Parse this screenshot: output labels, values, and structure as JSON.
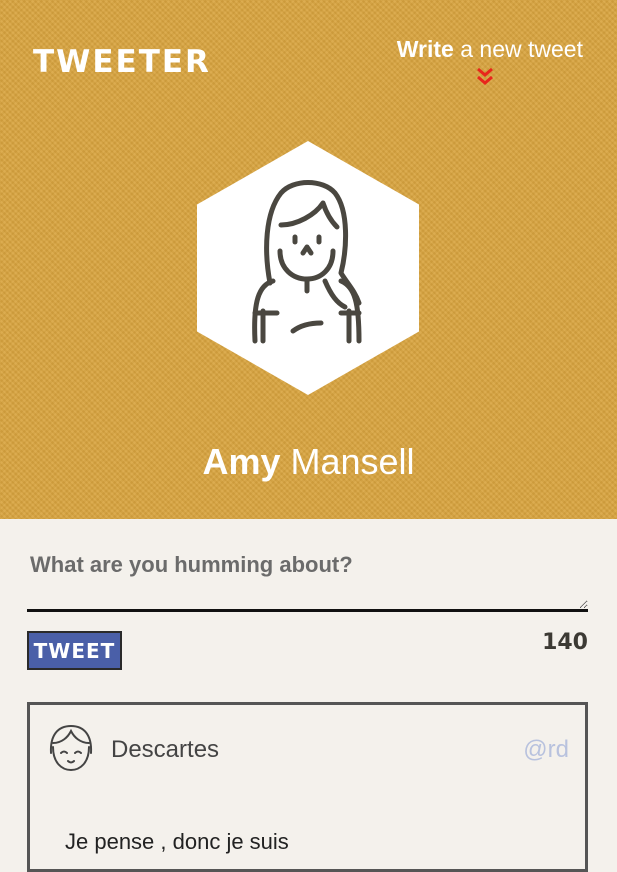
{
  "app": {
    "logo": "Tweeter"
  },
  "header": {
    "write_bold": "Write",
    "write_rest": " a new tweet",
    "colors": {
      "background": "#d9a43f",
      "chevron": "#e8261c"
    }
  },
  "profile": {
    "first_name": "Amy",
    "last_name": " Mansell"
  },
  "composer": {
    "placeholder": "What are you humming about?",
    "tweet_button": "Tweet",
    "char_count": "140",
    "colors": {
      "button": "#4a5fa8"
    }
  },
  "tweets": [
    {
      "user": "Descartes",
      "handle": "@rd",
      "text": "Je pense , donc je suis"
    }
  ]
}
